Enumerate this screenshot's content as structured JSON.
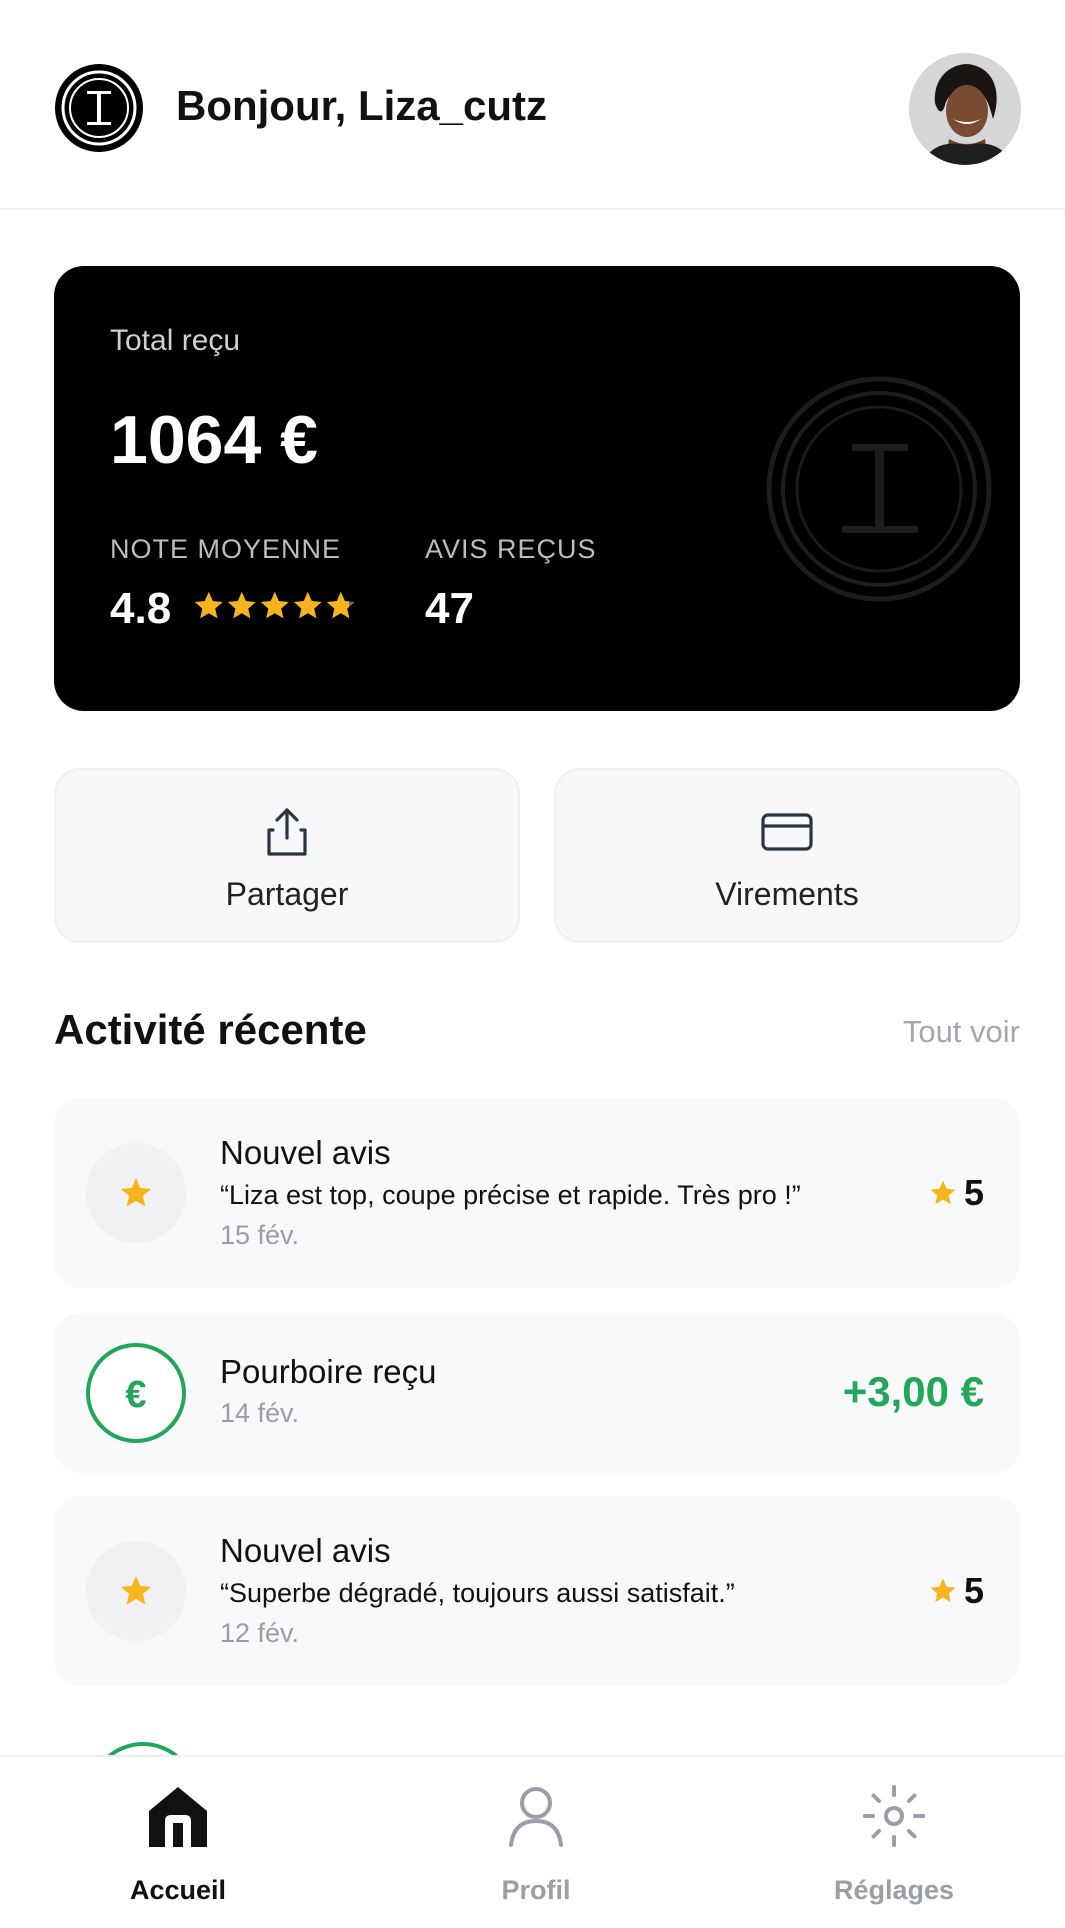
{
  "header": {
    "greeting": "Bonjour, Liza_cutz",
    "logo_icon": "barber-logo-icon",
    "avatar": "user-avatar"
  },
  "card": {
    "total_label": "Total reçu",
    "total_amount": "1064 €",
    "rating_label": "NOTE MOYENNE",
    "rating_value": "4.8",
    "rating_stars": 4.8,
    "reviews_label": "AVIS REÇUS",
    "reviews_value": "47"
  },
  "actions": [
    {
      "label": "Partager",
      "icon": "share-icon"
    },
    {
      "label": "Virements",
      "icon": "credit-card-icon"
    }
  ],
  "activity": {
    "title": "Activité récente",
    "see_all": "Tout voir",
    "items": [
      {
        "type": "review",
        "title": "Nouvel avis",
        "quote": "“Liza est top, coupe précise et rapide. Très pro !”",
        "date": "15 fév.",
        "rating": "5"
      },
      {
        "type": "tip",
        "title": "Pourboire reçu",
        "date": "14 fév.",
        "amount": "+3,00 €",
        "icon_glyph": "€"
      },
      {
        "type": "review",
        "title": "Nouvel avis",
        "quote": "“Superbe dégradé, toujours aussi satisfait.”",
        "date": "12 fév.",
        "rating": "5"
      }
    ]
  },
  "nav": [
    {
      "label": "Accueil",
      "icon": "home-icon",
      "active": true
    },
    {
      "label": "Profil",
      "icon": "profile-icon",
      "active": false
    },
    {
      "label": "Réglages",
      "icon": "settings-icon",
      "active": false
    }
  ],
  "colors": {
    "accent_green": "#23a55a",
    "star_gold": "#f6b51e",
    "card_bg": "#000000"
  }
}
